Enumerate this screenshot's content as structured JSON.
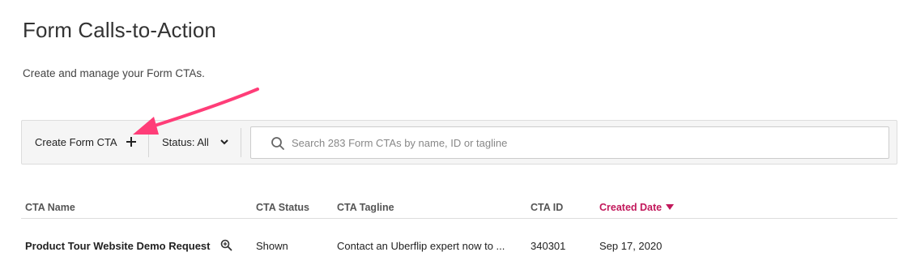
{
  "page": {
    "title": "Form Calls-to-Action",
    "subtitle": "Create and manage your Form CTAs."
  },
  "toolbar": {
    "create_label": "Create Form CTA",
    "create_icon": "plus-icon",
    "status_label": "Status: All",
    "status_icon": "chevron-down-icon",
    "search_icon": "search-icon",
    "search_placeholder": "Search 283 Form CTAs by name, ID or tagline",
    "search_value": ""
  },
  "annotation": {
    "arrow_color": "#ff3d78"
  },
  "table": {
    "columns": [
      "CTA Name",
      "CTA Status",
      "CTA Tagline",
      "CTA ID",
      "Created Date"
    ],
    "sorted_column": "Created Date",
    "sort_direction": "descending",
    "sort_color": "#c2185b",
    "rows": [
      {
        "name": "Product Tour Website Demo Request",
        "preview_icon": "zoom-in-icon",
        "status": "Shown",
        "tagline": "Contact an Uberflip expert now to ...",
        "id": "340301",
        "created": "Sep 17, 2020"
      }
    ]
  }
}
